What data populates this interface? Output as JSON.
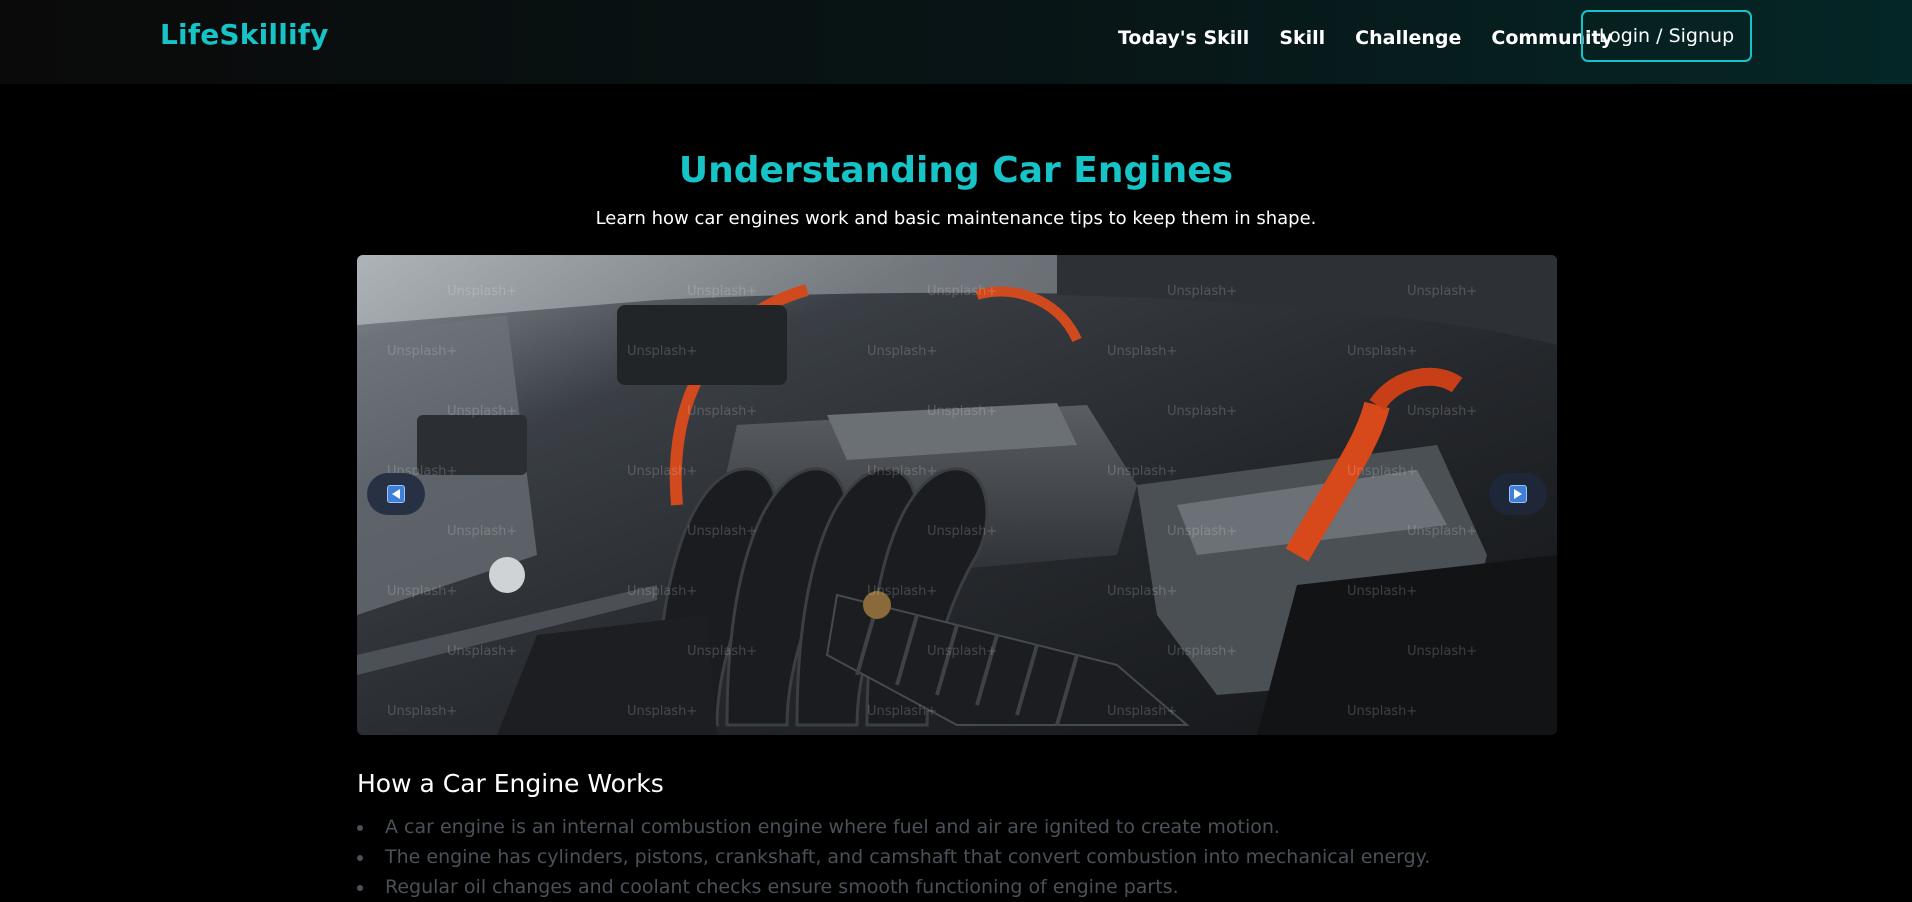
{
  "header": {
    "logo": "LifeSkillify",
    "nav": [
      "Today's Skill",
      "Skill",
      "Challenge",
      "Community"
    ],
    "login_label": "Login / Signup",
    "accent_color": "#16c3c6"
  },
  "main": {
    "title": "Understanding Car Engines",
    "subtitle": "Learn how car engines work and basic maintenance tips to keep them in shape.",
    "carousel": {
      "image_subject": "car engine bay",
      "prev_icon": "chevron-left-icon",
      "next_icon": "chevron-right-icon"
    },
    "section_title": "How a Car Engine Works",
    "bullets": [
      "A car engine is an internal combustion engine where fuel and air are ignited to create motion.",
      "The engine has cylinders, pistons, crankshaft, and camshaft that convert combustion into mechanical energy.",
      "Regular oil changes and coolant checks ensure smooth functioning of engine parts."
    ]
  }
}
